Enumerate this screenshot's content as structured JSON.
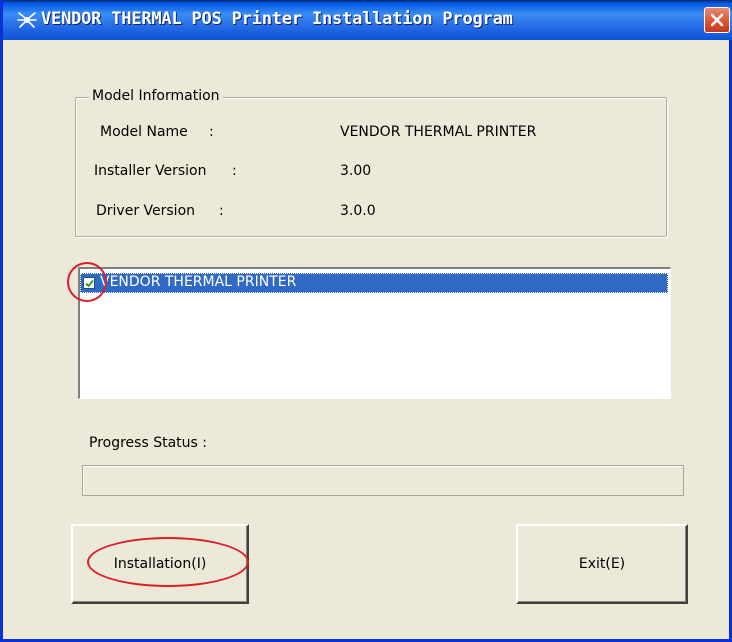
{
  "window": {
    "title": "VENDOR THERMAL POS Printer Installation Program"
  },
  "model_info": {
    "legend": "Model Information",
    "rows": [
      {
        "label": "Model Name",
        "colon": ":",
        "value": "VENDOR THERMAL PRINTER"
      },
      {
        "label": "Installer Version",
        "colon": ":",
        "value": "3.00"
      },
      {
        "label": "Driver Version",
        "colon": ":",
        "value": "3.0.0"
      }
    ]
  },
  "printer_list": {
    "items": [
      {
        "label": "VENDOR THERMAL PRINTER",
        "checked": true,
        "selected": true
      }
    ]
  },
  "progress": {
    "label": "Progress Status :",
    "value": 0
  },
  "buttons": {
    "install_label": "Installation(I)",
    "exit_label": "Exit(E)"
  },
  "colors": {
    "annotation": "#d9202a",
    "selection": "#316ac5",
    "titlebar": "#0058e6"
  }
}
